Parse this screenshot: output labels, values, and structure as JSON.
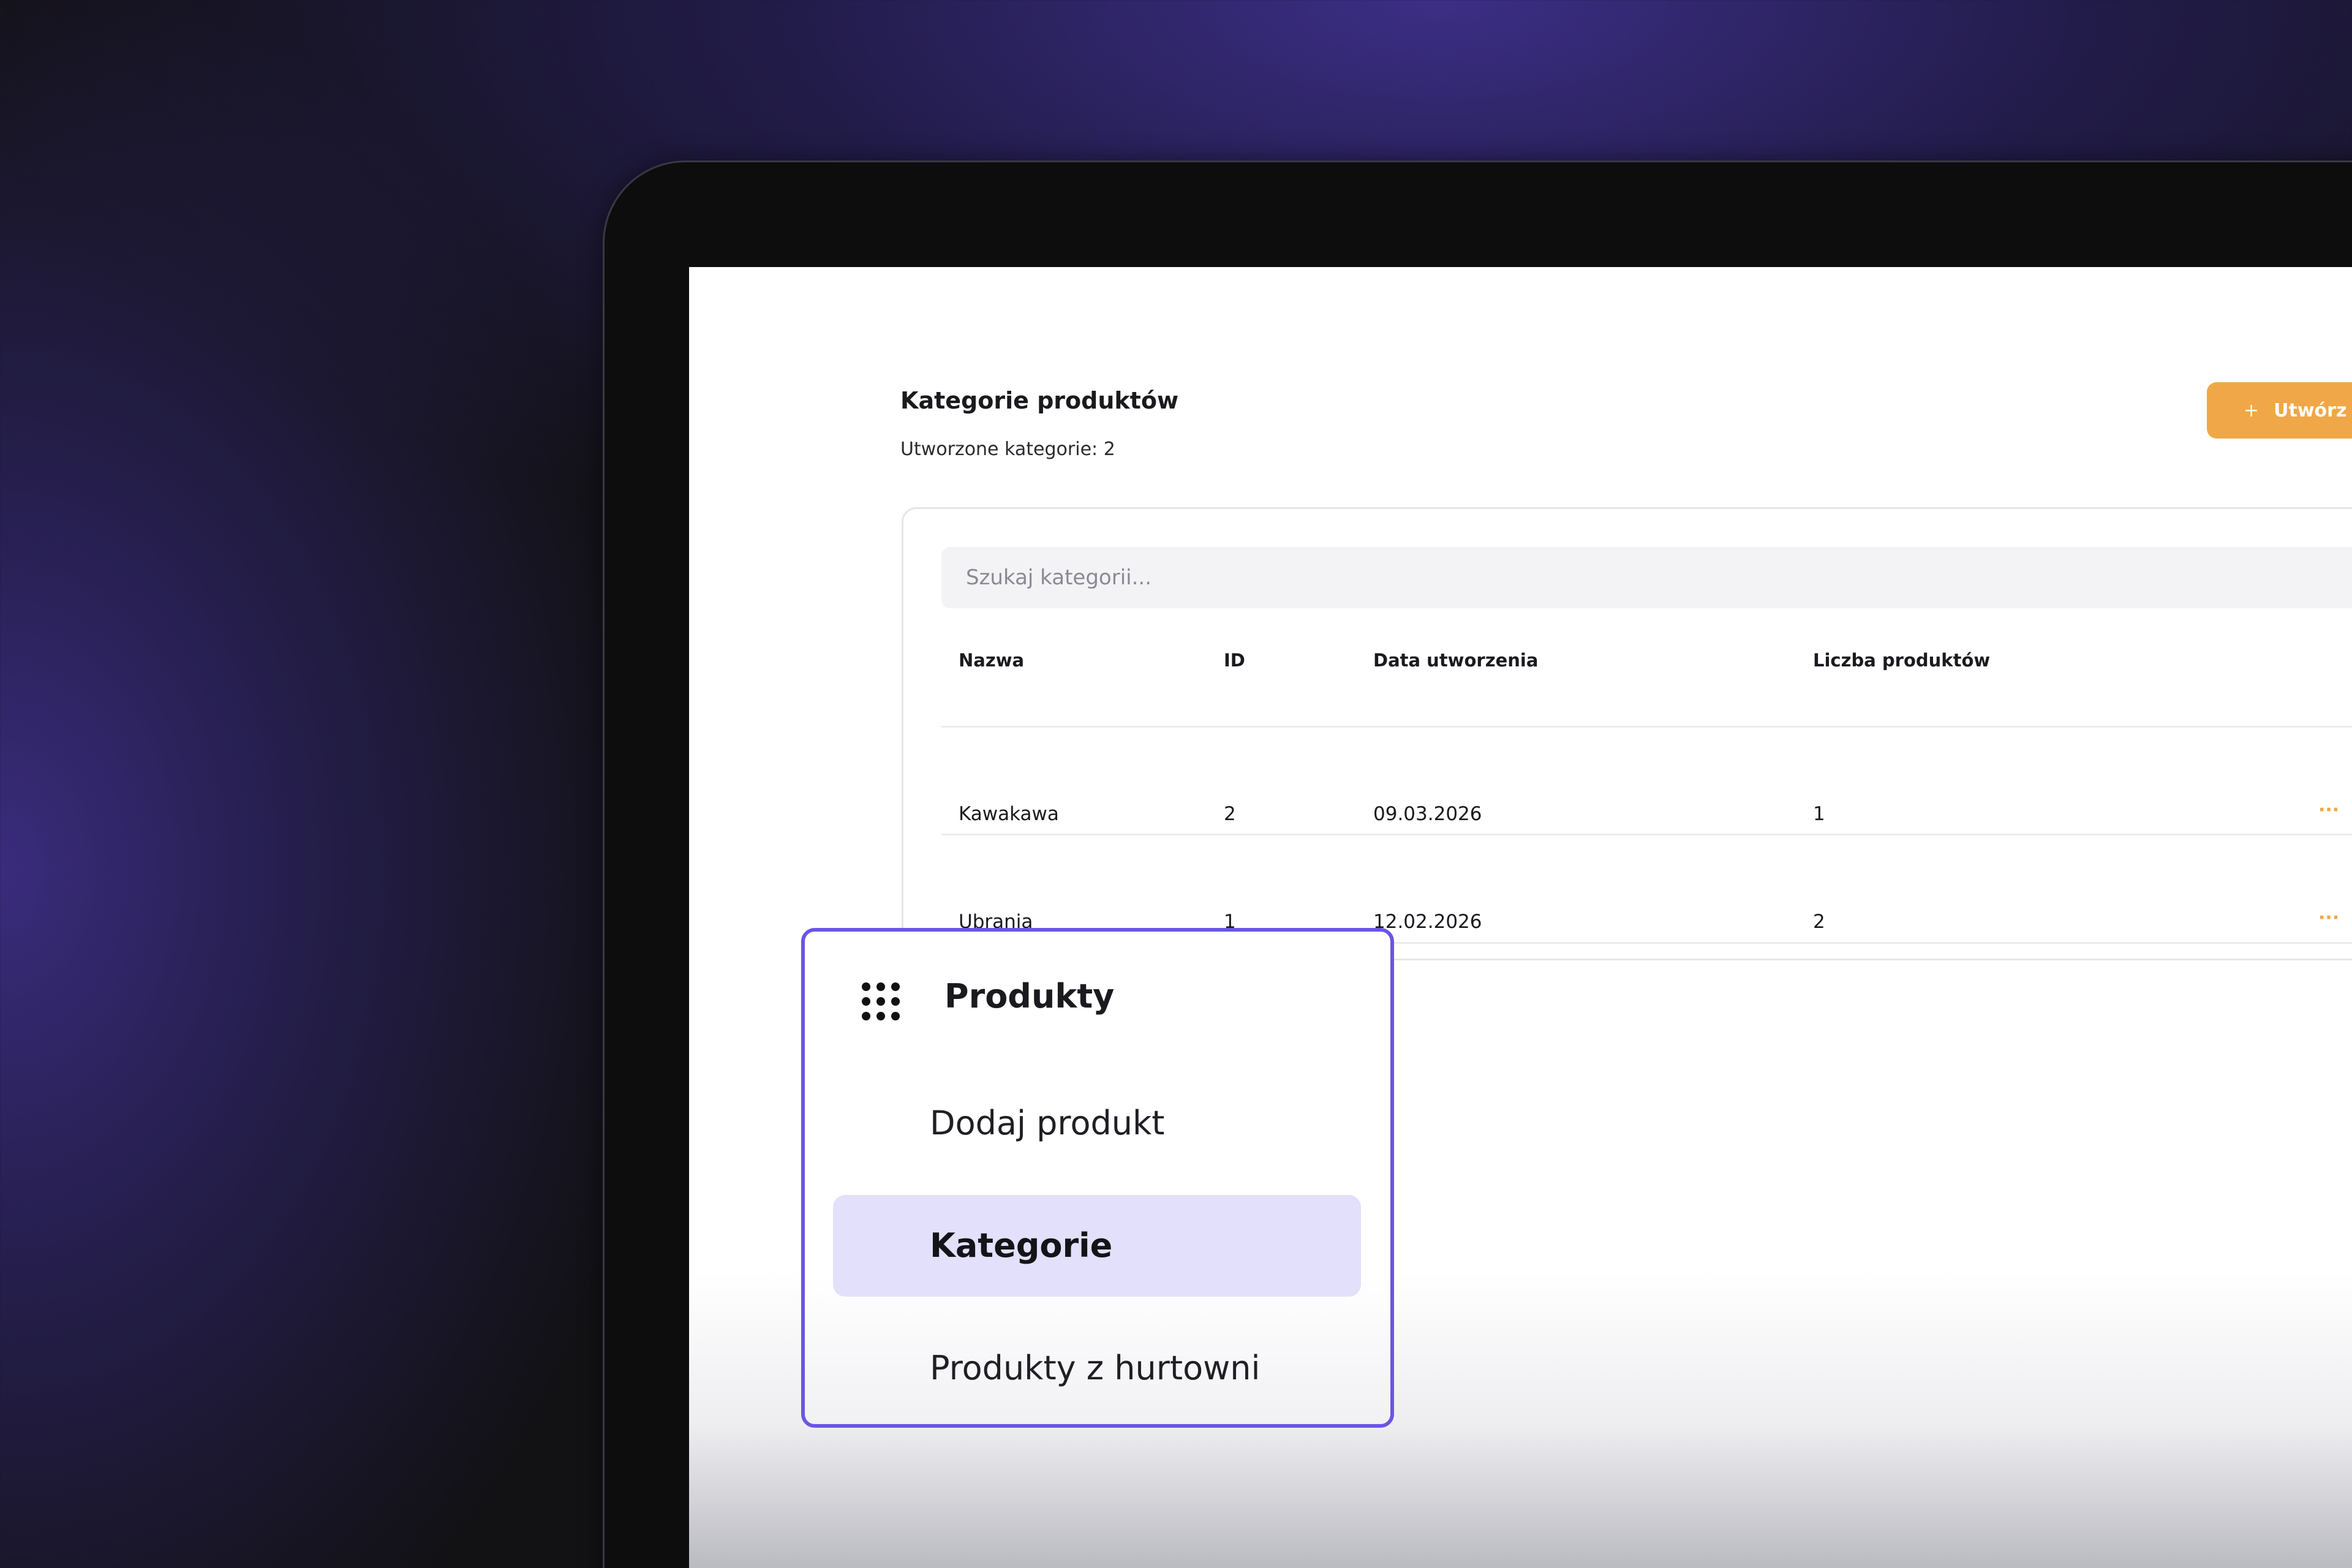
{
  "page": {
    "title": "Kategorie produktów",
    "subtitle_prefix": "Utworzone kategorie:",
    "count": "2",
    "create_button": "Utwórz"
  },
  "search": {
    "placeholder": "Szukaj kategorii..."
  },
  "table": {
    "columns": [
      "Nazwa",
      "ID",
      "Data utworzenia",
      "Liczba produktów"
    ],
    "rows": [
      {
        "name": "Kawakawa",
        "id": "2",
        "date": "09.03.2026",
        "products": "1",
        "actions": "···"
      },
      {
        "name": "Ubrania",
        "id": "1",
        "date": "12.02.2026",
        "products": "2",
        "actions": "···"
      }
    ]
  },
  "menu": {
    "title": "Produkty",
    "icon": "grid-dots-icon",
    "items": [
      {
        "label": "Dodaj produkt",
        "active": false
      },
      {
        "label": "Kategorie",
        "active": true
      },
      {
        "label": "Produkty z hurtowni",
        "active": false
      }
    ]
  },
  "colors": {
    "accent": "#f0a747",
    "menu_border": "#6a55e6",
    "menu_active_bg": "#e2e0fb"
  }
}
